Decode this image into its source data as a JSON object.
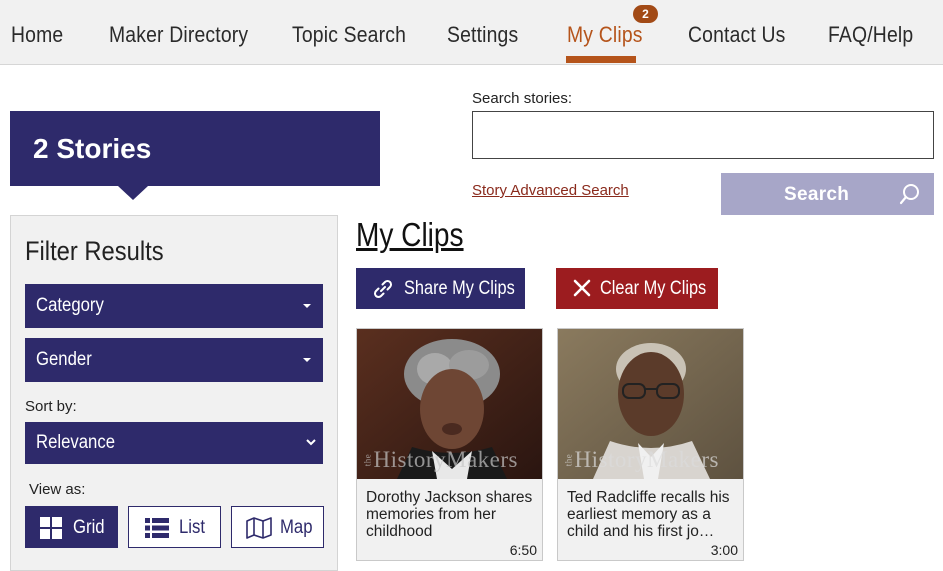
{
  "nav": {
    "items": [
      "Home",
      "Maker Directory",
      "Topic Search",
      "Settings",
      "My Clips",
      "Contact Us",
      "FAQ/Help"
    ],
    "active_index": 4,
    "badge": "2",
    "active_color": "#b5541b"
  },
  "banner": {
    "text": "2 Stories",
    "color": "#2e2a6b"
  },
  "search": {
    "label": "Search stories:",
    "value": "",
    "placeholder": "",
    "advanced_link": "Story Advanced Search",
    "button_label": "Search",
    "button_icon": "search-icon"
  },
  "filter": {
    "title": "Filter Results",
    "category": "Category",
    "gender": "Gender",
    "sort_label": "Sort by:",
    "sort_value": "Relevance",
    "view_label": "View as:",
    "views": [
      {
        "label": "Grid",
        "icon": "grid-icon",
        "selected": true
      },
      {
        "label": "List",
        "icon": "list-icon",
        "selected": false
      },
      {
        "label": "Map",
        "icon": "map-icon",
        "selected": false
      }
    ]
  },
  "clips": {
    "title": "My Clips",
    "share_label": "Share My Clips",
    "share_icon": "link-icon",
    "clear_label": "Clear My Clips",
    "clear_icon": "close-icon",
    "share_color": "#2e2a6b",
    "clear_color": "#9c1c1f",
    "watermark": "the HistoryMakers",
    "items": [
      {
        "title": "Dorothy Jackson shares memories from her childhood",
        "duration": "6:50"
      },
      {
        "title": "Ted Radcliffe recalls his earliest memory as a child and his first jo…",
        "duration": "3:00"
      }
    ]
  }
}
